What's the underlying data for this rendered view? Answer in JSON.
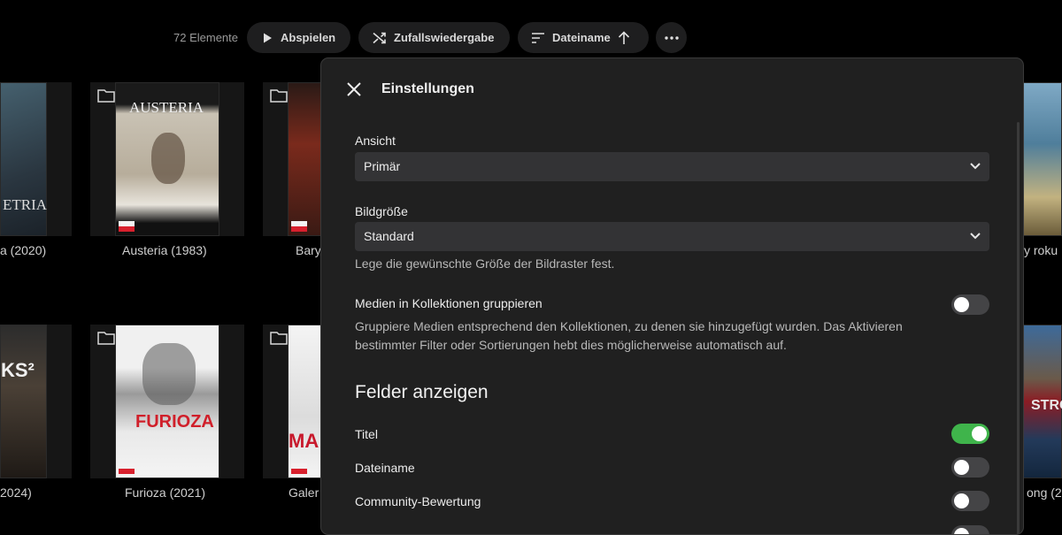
{
  "toolbar": {
    "count": "72 Elemente",
    "play_label": "Abspielen",
    "shuffle_label": "Zufallswiedergabe",
    "sort_label": "Dateiname"
  },
  "grid": {
    "row1": [
      "a (2020)",
      "Austeria (1983)",
      "Bary",
      "y roku"
    ],
    "row2": [
      "2024)",
      "Furioza (2021)",
      "Galer",
      "ong (2"
    ],
    "posters": {
      "austeria_title": "AUSTERIA",
      "furioza_title": "FURIOZA",
      "misc_text": [
        "ETRIA",
        "KS²",
        "MA",
        "STRO"
      ]
    }
  },
  "colors": {
    "background": "#000000",
    "modal_background": "#202020",
    "toggle_on": "#3fb44b",
    "toggle_off": "#444446",
    "select_background": "#333335"
  },
  "settings": {
    "title": "Einstellungen",
    "view": {
      "label": "Ansicht",
      "value": "Primär"
    },
    "image_size": {
      "label": "Bildgröße",
      "value": "Standard",
      "help": "Lege die gewünschte Größe der Bildraster fest."
    },
    "group_collections": {
      "label": "Medien in Kollektionen gruppieren",
      "help": "Gruppiere Medien entsprechend den Kollektionen, zu denen sie hinzugefügt wurden. Das Aktivieren bestimmter Filter oder Sortierungen hebt dies möglicherweise automatisch auf.",
      "enabled": false
    },
    "fields_section": "Felder anzeigen",
    "fields": [
      {
        "label": "Titel",
        "enabled": true
      },
      {
        "label": "Dateiname",
        "enabled": false
      },
      {
        "label": "Community-Bewertung",
        "enabled": false
      }
    ]
  }
}
